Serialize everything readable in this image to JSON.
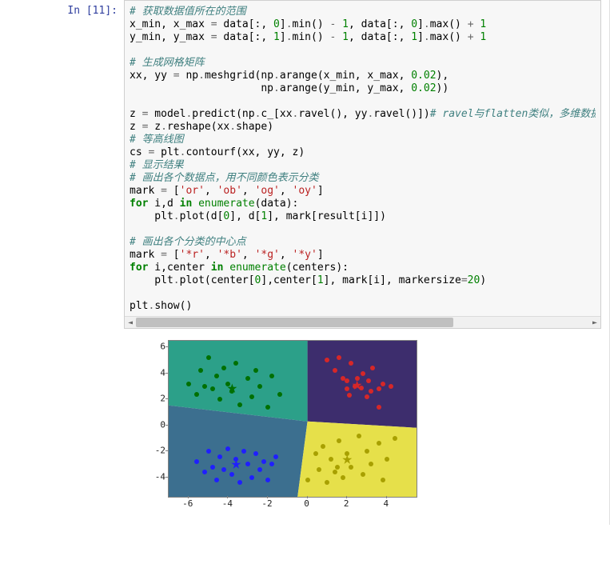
{
  "prompt": {
    "label": "In [11]:"
  },
  "code": {
    "lines": [
      {
        "t": "comment",
        "s": "# 获取数据值所在的范围"
      },
      {
        "t": "line",
        "parts": [
          {
            "k": "plain",
            "s": "x_min, x_max "
          },
          {
            "k": "op",
            "s": "="
          },
          {
            "k": "plain",
            "s": " data[:, "
          },
          {
            "k": "num",
            "s": "0"
          },
          {
            "k": "plain",
            "s": "]"
          },
          {
            "k": "op",
            "s": "."
          },
          {
            "k": "plain",
            "s": "min() "
          },
          {
            "k": "op",
            "s": "-"
          },
          {
            "k": "plain",
            "s": " "
          },
          {
            "k": "num",
            "s": "1"
          },
          {
            "k": "plain",
            "s": ", data[:, "
          },
          {
            "k": "num",
            "s": "0"
          },
          {
            "k": "plain",
            "s": "]"
          },
          {
            "k": "op",
            "s": "."
          },
          {
            "k": "plain",
            "s": "max() "
          },
          {
            "k": "op",
            "s": "+"
          },
          {
            "k": "plain",
            "s": " "
          },
          {
            "k": "num",
            "s": "1"
          }
        ]
      },
      {
        "t": "line",
        "parts": [
          {
            "k": "plain",
            "s": "y_min, y_max "
          },
          {
            "k": "op",
            "s": "="
          },
          {
            "k": "plain",
            "s": " data[:, "
          },
          {
            "k": "num",
            "s": "1"
          },
          {
            "k": "plain",
            "s": "]"
          },
          {
            "k": "op",
            "s": "."
          },
          {
            "k": "plain",
            "s": "min() "
          },
          {
            "k": "op",
            "s": "-"
          },
          {
            "k": "plain",
            "s": " "
          },
          {
            "k": "num",
            "s": "1"
          },
          {
            "k": "plain",
            "s": ", data[:, "
          },
          {
            "k": "num",
            "s": "1"
          },
          {
            "k": "plain",
            "s": "]"
          },
          {
            "k": "op",
            "s": "."
          },
          {
            "k": "plain",
            "s": "max() "
          },
          {
            "k": "op",
            "s": "+"
          },
          {
            "k": "plain",
            "s": " "
          },
          {
            "k": "num",
            "s": "1"
          }
        ]
      },
      {
        "t": "blank"
      },
      {
        "t": "comment",
        "s": "# 生成网格矩阵"
      },
      {
        "t": "line",
        "parts": [
          {
            "k": "plain",
            "s": "xx, yy "
          },
          {
            "k": "op",
            "s": "="
          },
          {
            "k": "plain",
            "s": " np"
          },
          {
            "k": "op",
            "s": "."
          },
          {
            "k": "plain",
            "s": "meshgrid(np"
          },
          {
            "k": "op",
            "s": "."
          },
          {
            "k": "plain",
            "s": "arange(x_min, x_max, "
          },
          {
            "k": "num",
            "s": "0.02"
          },
          {
            "k": "plain",
            "s": "),"
          }
        ]
      },
      {
        "t": "line",
        "parts": [
          {
            "k": "plain",
            "s": "                     np"
          },
          {
            "k": "op",
            "s": "."
          },
          {
            "k": "plain",
            "s": "arange(y_min, y_max, "
          },
          {
            "k": "num",
            "s": "0.02"
          },
          {
            "k": "plain",
            "s": "))"
          }
        ]
      },
      {
        "t": "blank"
      },
      {
        "t": "line",
        "parts": [
          {
            "k": "plain",
            "s": "z "
          },
          {
            "k": "op",
            "s": "="
          },
          {
            "k": "plain",
            "s": " model"
          },
          {
            "k": "op",
            "s": "."
          },
          {
            "k": "plain",
            "s": "predict(np"
          },
          {
            "k": "op",
            "s": "."
          },
          {
            "k": "plain",
            "s": "c_[xx"
          },
          {
            "k": "op",
            "s": "."
          },
          {
            "k": "plain",
            "s": "ravel(), yy"
          },
          {
            "k": "op",
            "s": "."
          },
          {
            "k": "plain",
            "s": "ravel()])"
          },
          {
            "k": "comment",
            "s": "# ravel与flatten类似，多维数据转一"
          }
        ]
      },
      {
        "t": "line",
        "parts": [
          {
            "k": "plain",
            "s": "z "
          },
          {
            "k": "op",
            "s": "="
          },
          {
            "k": "plain",
            "s": " z"
          },
          {
            "k": "op",
            "s": "."
          },
          {
            "k": "plain",
            "s": "reshape(xx"
          },
          {
            "k": "op",
            "s": "."
          },
          {
            "k": "plain",
            "s": "shape)"
          }
        ]
      },
      {
        "t": "comment",
        "s": "# 等高线图"
      },
      {
        "t": "line",
        "parts": [
          {
            "k": "plain",
            "s": "cs "
          },
          {
            "k": "op",
            "s": "="
          },
          {
            "k": "plain",
            "s": " plt"
          },
          {
            "k": "op",
            "s": "."
          },
          {
            "k": "plain",
            "s": "contourf(xx, yy, z)"
          }
        ]
      },
      {
        "t": "comment",
        "s": "# 显示结果"
      },
      {
        "t": "comment",
        "s": "# 画出各个数据点，用不同颜色表示分类"
      },
      {
        "t": "line",
        "parts": [
          {
            "k": "plain",
            "s": "mark "
          },
          {
            "k": "op",
            "s": "="
          },
          {
            "k": "plain",
            "s": " ["
          },
          {
            "k": "str",
            "s": "'or'"
          },
          {
            "k": "plain",
            "s": ", "
          },
          {
            "k": "str",
            "s": "'ob'"
          },
          {
            "k": "plain",
            "s": ", "
          },
          {
            "k": "str",
            "s": "'og'"
          },
          {
            "k": "plain",
            "s": ", "
          },
          {
            "k": "str",
            "s": "'oy'"
          },
          {
            "k": "plain",
            "s": "]"
          }
        ]
      },
      {
        "t": "line",
        "parts": [
          {
            "k": "kw",
            "s": "for"
          },
          {
            "k": "plain",
            "s": " i,d "
          },
          {
            "k": "kw",
            "s": "in"
          },
          {
            "k": "plain",
            "s": " "
          },
          {
            "k": "builtin",
            "s": "enumerate"
          },
          {
            "k": "plain",
            "s": "(data):"
          }
        ]
      },
      {
        "t": "line",
        "parts": [
          {
            "k": "plain",
            "s": "    plt"
          },
          {
            "k": "op",
            "s": "."
          },
          {
            "k": "plain",
            "s": "plot(d["
          },
          {
            "k": "num",
            "s": "0"
          },
          {
            "k": "plain",
            "s": "], d["
          },
          {
            "k": "num",
            "s": "1"
          },
          {
            "k": "plain",
            "s": "], mark[result[i]])"
          }
        ]
      },
      {
        "t": "blank"
      },
      {
        "t": "comment",
        "s": "# 画出各个分类的中心点"
      },
      {
        "t": "line",
        "parts": [
          {
            "k": "plain",
            "s": "mark "
          },
          {
            "k": "op",
            "s": "="
          },
          {
            "k": "plain",
            "s": " ["
          },
          {
            "k": "str",
            "s": "'*r'"
          },
          {
            "k": "plain",
            "s": ", "
          },
          {
            "k": "str",
            "s": "'*b'"
          },
          {
            "k": "plain",
            "s": ", "
          },
          {
            "k": "str",
            "s": "'*g'"
          },
          {
            "k": "plain",
            "s": ", "
          },
          {
            "k": "str",
            "s": "'*y'"
          },
          {
            "k": "plain",
            "s": "]"
          }
        ]
      },
      {
        "t": "line",
        "parts": [
          {
            "k": "kw",
            "s": "for"
          },
          {
            "k": "plain",
            "s": " i,center "
          },
          {
            "k": "kw",
            "s": "in"
          },
          {
            "k": "plain",
            "s": " "
          },
          {
            "k": "builtin",
            "s": "enumerate"
          },
          {
            "k": "plain",
            "s": "(centers):"
          }
        ]
      },
      {
        "t": "line",
        "parts": [
          {
            "k": "plain",
            "s": "    plt"
          },
          {
            "k": "op",
            "s": "."
          },
          {
            "k": "plain",
            "s": "plot(center["
          },
          {
            "k": "num",
            "s": "0"
          },
          {
            "k": "plain",
            "s": "],center["
          },
          {
            "k": "num",
            "s": "1"
          },
          {
            "k": "plain",
            "s": "], mark[i], markersize"
          },
          {
            "k": "op",
            "s": "="
          },
          {
            "k": "num",
            "s": "20"
          },
          {
            "k": "plain",
            "s": ")"
          }
        ]
      },
      {
        "t": "blank"
      },
      {
        "t": "line",
        "parts": [
          {
            "k": "plain",
            "s": "plt"
          },
          {
            "k": "op",
            "s": "."
          },
          {
            "k": "plain",
            "s": "show()"
          }
        ]
      }
    ]
  },
  "scroll": {
    "thumb_pct": 70,
    "thumb_left_pct": 0
  },
  "chart_data": {
    "type": "scatter",
    "title": "",
    "xlabel": "",
    "ylabel": "",
    "xlim": [
      -7,
      5.5
    ],
    "ylim": [
      -5.5,
      6.5
    ],
    "xticks": [
      -6,
      -4,
      -2,
      0,
      2,
      4
    ],
    "yticks": [
      -4,
      -2,
      0,
      2,
      4,
      6
    ],
    "regions": [
      {
        "name": "green",
        "color": "#2ca089",
        "vertices": "upper-left"
      },
      {
        "name": "purple",
        "color": "#3d2d6d",
        "vertices": "upper-right"
      },
      {
        "name": "blue",
        "color": "#3c6f8f",
        "vertices": "lower-left"
      },
      {
        "name": "yellow",
        "color": "#e6e04a",
        "vertices": "lower-right"
      }
    ],
    "series": [
      {
        "name": "cluster-red",
        "color": "#d62728",
        "marker": "o",
        "points": [
          [
            1.0,
            5.0
          ],
          [
            1.4,
            4.2
          ],
          [
            1.6,
            5.2
          ],
          [
            1.8,
            3.6
          ],
          [
            2.0,
            2.8
          ],
          [
            2.0,
            3.4
          ],
          [
            2.1,
            2.3
          ],
          [
            2.2,
            4.8
          ],
          [
            2.4,
            3.0
          ],
          [
            2.5,
            3.6
          ],
          [
            2.7,
            2.9
          ],
          [
            2.8,
            4.0
          ],
          [
            3.0,
            2.2
          ],
          [
            3.1,
            3.4
          ],
          [
            3.2,
            2.6
          ],
          [
            3.3,
            4.4
          ],
          [
            3.6,
            1.4
          ],
          [
            3.6,
            2.8
          ],
          [
            3.8,
            3.2
          ],
          [
            4.2,
            3.0
          ]
        ]
      },
      {
        "name": "cluster-blue",
        "color": "#1f1fff",
        "marker": "o",
        "points": [
          [
            -5.6,
            -2.8
          ],
          [
            -5.2,
            -3.6
          ],
          [
            -5.0,
            -2.0
          ],
          [
            -4.8,
            -3.2
          ],
          [
            -4.6,
            -4.2
          ],
          [
            -4.4,
            -2.4
          ],
          [
            -4.2,
            -3.4
          ],
          [
            -4.0,
            -1.8
          ],
          [
            -3.8,
            -3.8
          ],
          [
            -3.6,
            -2.6
          ],
          [
            -3.4,
            -4.4
          ],
          [
            -3.2,
            -2.0
          ],
          [
            -3.0,
            -3.0
          ],
          [
            -2.8,
            -4.0
          ],
          [
            -2.6,
            -2.2
          ],
          [
            -2.4,
            -3.4
          ],
          [
            -2.2,
            -2.8
          ],
          [
            -2.0,
            -4.2
          ],
          [
            -1.8,
            -3.0
          ],
          [
            -1.6,
            -2.4
          ]
        ]
      },
      {
        "name": "cluster-green",
        "color": "#007000",
        "marker": "o",
        "points": [
          [
            -6.0,
            3.2
          ],
          [
            -5.6,
            2.4
          ],
          [
            -5.4,
            4.2
          ],
          [
            -5.2,
            3.0
          ],
          [
            -5.0,
            5.2
          ],
          [
            -4.8,
            2.8
          ],
          [
            -4.6,
            3.8
          ],
          [
            -4.4,
            2.0
          ],
          [
            -4.2,
            4.4
          ],
          [
            -4.0,
            3.2
          ],
          [
            -3.8,
            2.6
          ],
          [
            -3.6,
            4.8
          ],
          [
            -3.4,
            1.6
          ],
          [
            -3.0,
            3.6
          ],
          [
            -2.8,
            2.2
          ],
          [
            -2.6,
            4.2
          ],
          [
            -2.4,
            3.0
          ],
          [
            -2.0,
            1.4
          ],
          [
            -1.8,
            3.8
          ],
          [
            -1.4,
            2.4
          ]
        ]
      },
      {
        "name": "cluster-yellow",
        "color": "#a8a000",
        "marker": "o",
        "points": [
          [
            0.0,
            -4.2
          ],
          [
            0.4,
            -2.2
          ],
          [
            0.6,
            -3.4
          ],
          [
            0.8,
            -1.6
          ],
          [
            1.0,
            -4.4
          ],
          [
            1.2,
            -2.6
          ],
          [
            1.4,
            -3.6
          ],
          [
            1.5,
            -3.2
          ],
          [
            1.6,
            -1.2
          ],
          [
            1.8,
            -4.0
          ],
          [
            2.0,
            -2.2
          ],
          [
            2.2,
            -3.2
          ],
          [
            2.6,
            -0.8
          ],
          [
            2.8,
            -3.8
          ],
          [
            3.0,
            -2.0
          ],
          [
            3.2,
            -3.0
          ],
          [
            3.6,
            -1.4
          ],
          [
            3.8,
            -4.2
          ],
          [
            4.0,
            -2.6
          ],
          [
            4.4,
            -1.0
          ]
        ]
      }
    ],
    "centers": [
      {
        "name": "center-red",
        "color": "#d62728",
        "marker": "*",
        "point": [
          2.5,
          3.1
        ]
      },
      {
        "name": "center-blue",
        "color": "#1f1fff",
        "marker": "*",
        "point": [
          -3.6,
          -3.0
        ]
      },
      {
        "name": "center-green",
        "color": "#007000",
        "marker": "*",
        "point": [
          -3.8,
          2.9
        ]
      },
      {
        "name": "center-yellow",
        "color": "#a8a000",
        "marker": "*",
        "point": [
          2.0,
          -2.6
        ]
      }
    ]
  }
}
